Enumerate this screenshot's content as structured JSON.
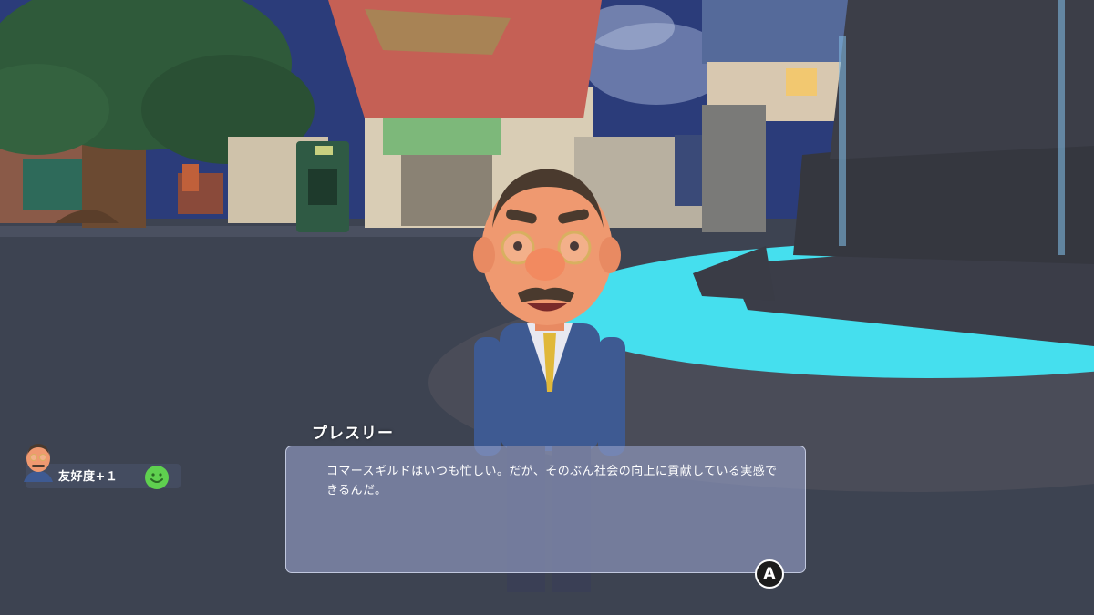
{
  "hud": {
    "friendship_text": "友好度+１",
    "friendship_status_icon": "smile-face-icon",
    "friendship_portrait_icon": "npc-portrait-icon"
  },
  "dialog": {
    "speaker": "プレスリー",
    "text": "コマースギルドはいつも忙しい。だが、そのぶん社会の向上に貢献している実感できるんだ。",
    "advance_button_label": "A",
    "advance_icon": "a-button-icon"
  },
  "colors": {
    "water": "#4fd8ee",
    "dialog_bg": "#96a0c8",
    "smile_green": "#5fd04f",
    "suit_blue": "#3e5a92",
    "tie_yellow": "#e0b83a"
  }
}
